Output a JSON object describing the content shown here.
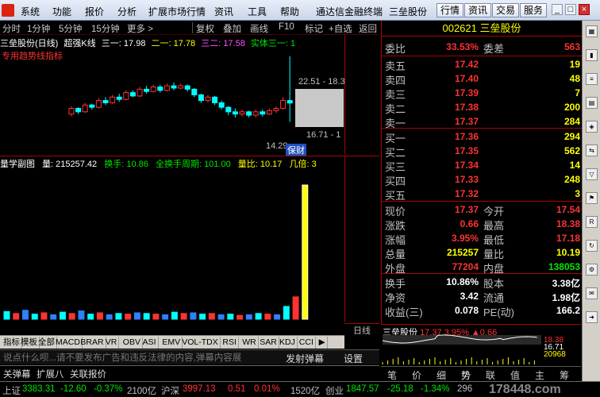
{
  "menu": {
    "items": [
      "系统",
      "功能",
      "报价",
      "分析",
      "扩展市场行情",
      "资讯",
      "工具",
      "帮助"
    ],
    "app_title": "通达信金融终端",
    "stock_title": "三垒股份",
    "buttons": [
      "行情",
      "资讯",
      "交易",
      "服务"
    ]
  },
  "chartbar": {
    "periods": [
      "分时",
      "1分钟",
      "5分钟",
      "15分钟",
      "更多 >"
    ],
    "tools": [
      "复权",
      "叠加",
      "画线",
      "F10",
      "标记",
      "+自选",
      "返回"
    ]
  },
  "main_chart": {
    "stock": "三垒股份(日线)",
    "indicator": "超强K线",
    "s1_label": "三一: 17.98",
    "s2_label": "二一: 17.78",
    "s3_label": "三二: 17.58",
    "s4_label": "实体三一: 1",
    "overlay_note": "专用趋势线指标",
    "high_label": "22.51 - 18.3",
    "low_mark": "16.71 - 1",
    "low_price": "14.29",
    "hint": "保财",
    "candles": [
      {
        "o": 17.4,
        "c": 17.9,
        "h": 18.1,
        "l": 17.2
      },
      {
        "o": 17.9,
        "c": 17.6,
        "h": 18.0,
        "l": 17.4
      },
      {
        "o": 17.6,
        "c": 18.2,
        "h": 18.4,
        "l": 17.5
      },
      {
        "o": 18.2,
        "c": 18.0,
        "h": 18.3,
        "l": 17.8
      },
      {
        "o": 18.0,
        "c": 18.6,
        "h": 18.8,
        "l": 17.9
      },
      {
        "o": 18.6,
        "c": 18.4,
        "h": 18.9,
        "l": 18.2
      },
      {
        "o": 18.4,
        "c": 18.9,
        "h": 19.1,
        "l": 18.3
      },
      {
        "o": 18.9,
        "c": 18.7,
        "h": 19.2,
        "l": 18.5
      },
      {
        "o": 18.7,
        "c": 19.3,
        "h": 19.5,
        "l": 18.6
      },
      {
        "o": 19.3,
        "c": 19.0,
        "h": 19.5,
        "l": 18.9
      },
      {
        "o": 19.0,
        "c": 19.6,
        "h": 19.8,
        "l": 18.9
      },
      {
        "o": 19.6,
        "c": 19.4,
        "h": 19.9,
        "l": 19.2
      },
      {
        "o": 19.4,
        "c": 19.8,
        "h": 20.0,
        "l": 19.3
      },
      {
        "o": 19.8,
        "c": 19.5,
        "h": 20.0,
        "l": 19.3
      },
      {
        "o": 19.5,
        "c": 19.9,
        "h": 20.1,
        "l": 19.4
      },
      {
        "o": 19.9,
        "c": 19.7,
        "h": 20.2,
        "l": 19.5
      },
      {
        "o": 19.7,
        "c": 19.9,
        "h": 20.1,
        "l": 19.6
      },
      {
        "o": 19.9,
        "c": 19.6,
        "h": 20.0,
        "l": 19.4
      },
      {
        "o": 19.6,
        "c": 19.1,
        "h": 19.7,
        "l": 18.9
      },
      {
        "o": 19.1,
        "c": 18.6,
        "h": 19.2,
        "l": 18.4
      },
      {
        "o": 18.6,
        "c": 18.9,
        "h": 19.1,
        "l": 18.4
      },
      {
        "o": 18.9,
        "c": 18.4,
        "h": 19.0,
        "l": 18.2
      },
      {
        "o": 18.4,
        "c": 18.0,
        "h": 18.6,
        "l": 17.8
      },
      {
        "o": 18.0,
        "c": 17.6,
        "h": 18.1,
        "l": 17.3
      },
      {
        "o": 17.6,
        "c": 17.4,
        "h": 17.9,
        "l": 17.1
      },
      {
        "o": 17.4,
        "c": 17.6,
        "h": 17.8,
        "l": 17.2
      },
      {
        "o": 17.6,
        "c": 17.3,
        "h": 17.7,
        "l": 17.1
      },
      {
        "o": 17.3,
        "c": 17.6,
        "h": 17.8,
        "l": 17.1
      },
      {
        "o": 17.6,
        "c": 17.4,
        "h": 17.8,
        "l": 17.2
      },
      {
        "o": 17.4,
        "c": 17.7,
        "h": 17.9,
        "l": 17.3
      },
      {
        "o": 17.7,
        "c": 17.9,
        "h": 18.1,
        "l": 17.5
      },
      {
        "o": 17.9,
        "c": 18.6,
        "h": 18.9,
        "l": 17.8
      },
      {
        "o": 18.6,
        "c": 18.38,
        "h": 22.51,
        "l": 16.71
      }
    ],
    "price_range": [
      14.0,
      23.0
    ]
  },
  "vol_chart": {
    "title": "量学副图",
    "vol_label": "量: 215257.42",
    "turnover_label": "换手: 10.86",
    "full_turnover_label": "全换手周期: 101.00",
    "vol_ratio_label": "量比: 10.17",
    "multiple_label": "几倍: 3",
    "volumes": [
      12,
      9,
      14,
      8,
      10,
      7,
      11,
      9,
      13,
      8,
      10,
      7,
      9,
      8,
      10,
      9,
      8,
      7,
      11,
      9,
      10,
      8,
      9,
      7,
      8,
      6,
      7,
      9,
      8,
      7,
      20,
      35,
      210
    ],
    "vmax": 230
  },
  "day_label": "日线",
  "ind_tabs": [
    "指标",
    "模板",
    "全部",
    "MACD",
    "BRAR",
    "VR",
    "OBV",
    "ASI",
    "EMV",
    "VOL-TDX",
    "RSI",
    "WR",
    "SAR",
    "KDJ",
    "CCI",
    "▶"
  ],
  "chat": {
    "placeholder": "说点什么呗...请不要发布广告和违反法律的内容,弹幕内容展",
    "send": "发射弹幕",
    "settings": "设置"
  },
  "bottom_tabs": [
    "关弹幕",
    "扩展八",
    "关联报价"
  ],
  "status": {
    "sh_name": "上证",
    "sh_value": "3383.31",
    "sh_change": "-12.60",
    "sh_pct": "-0.37%",
    "sh_amt": "2100亿",
    "hs_name": "沪深",
    "hs_value": "3997.13",
    "hs_change": "0.51",
    "hs_pct": "0.01%",
    "hs_amt": "1520亿",
    "cy_name": "创业",
    "cy_value": "1847.57",
    "cy_change": "-25.18",
    "cy_pct": "-1.34%",
    "cy_amt": "296"
  },
  "quote": {
    "code": "002621",
    "name": "三垒股份",
    "weibi_label": "委比",
    "weibi_value": "33.53%",
    "weicha_label": "委差",
    "weicha_value": "563",
    "asks": [
      {
        "label": "卖五",
        "price": "17.42",
        "vol": "19"
      },
      {
        "label": "卖四",
        "price": "17.40",
        "vol": "48"
      },
      {
        "label": "卖三",
        "price": "17.39",
        "vol": "7"
      },
      {
        "label": "卖二",
        "price": "17.38",
        "vol": "200"
      },
      {
        "label": "卖一",
        "price": "17.37",
        "vol": "284"
      }
    ],
    "bids": [
      {
        "label": "买一",
        "price": "17.36",
        "vol": "294"
      },
      {
        "label": "买二",
        "price": "17.35",
        "vol": "562"
      },
      {
        "label": "买三",
        "price": "17.34",
        "vol": "14"
      },
      {
        "label": "买四",
        "price": "17.33",
        "vol": "248"
      },
      {
        "label": "买五",
        "price": "17.32",
        "vol": "3"
      }
    ],
    "stats": [
      {
        "l1": "现价",
        "v1": "17.37",
        "c1": "red",
        "l2": "今开",
        "v2": "17.54",
        "c2": "red"
      },
      {
        "l1": "涨跌",
        "v1": "0.66",
        "c1": "red",
        "l2": "最高",
        "v2": "18.38",
        "c2": "red"
      },
      {
        "l1": "涨幅",
        "v1": "3.95%",
        "c1": "red",
        "l2": "最低",
        "v2": "17.18",
        "c2": "red"
      },
      {
        "l1": "总量",
        "v1": "215257",
        "c1": "yellow",
        "l2": "量比",
        "v2": "10.19",
        "c2": "yellow"
      },
      {
        "l1": "外盘",
        "v1": "77204",
        "c1": "red",
        "l2": "内盘",
        "v2": "138053",
        "c2": "green"
      }
    ],
    "fund": [
      {
        "l1": "换手",
        "v1": "10.86%",
        "l2": "股本",
        "v2": "3.38亿"
      },
      {
        "l1": "净资",
        "v1": "3.42",
        "l2": "流通",
        "v2": "1.98亿"
      },
      {
        "l1": "收益(三)",
        "v1": "0.078",
        "l2": "PE(动)",
        "v2": "166.2"
      }
    ]
  },
  "mini": {
    "name": "三垒股份",
    "price": "17.37",
    "pct": "3.95%",
    "chg": "▲0.66",
    "hi": "18.38",
    "lo": "16.71",
    "vol": "20968"
  },
  "quote_tabs": [
    "笔",
    "价",
    "细",
    "势",
    "联",
    "值",
    "主",
    "筹"
  ],
  "watermark": "178448.com",
  "colors": {
    "up": "#ff3232",
    "down": "#00e600",
    "accent_yellow": "#ffff00",
    "cyan": "#00ffff",
    "frame": "#aa0000"
  },
  "icons": [
    "chart-icon",
    "bar-icon",
    "list-icon",
    "grid-icon",
    "analysis-icon",
    "compare-icon",
    "filter-icon",
    "flag-icon",
    "rsi-icon",
    "refresh-icon",
    "settings-icon",
    "news-icon",
    "arrow-icon"
  ]
}
